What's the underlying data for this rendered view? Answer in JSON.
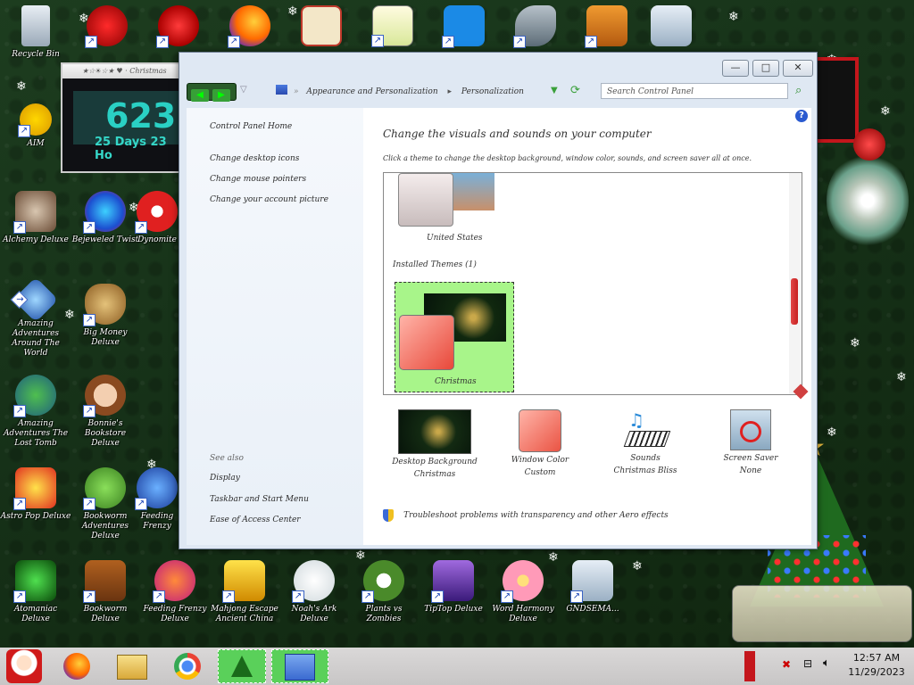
{
  "desktop": {
    "icons": [
      {
        "label": "Recycle Bin"
      },
      {
        "label": ""
      },
      {
        "label": ""
      },
      {
        "label": ""
      },
      {
        "label": ""
      },
      {
        "label": ""
      },
      {
        "label": ""
      },
      {
        "label": ""
      },
      {
        "label": ""
      },
      {
        "label": "AIM"
      },
      {
        "label": "Alchemy Deluxe"
      },
      {
        "label": "Bejeweled Twist"
      },
      {
        "label": "Dynomite"
      },
      {
        "label": "Amazing Adventures Around The World"
      },
      {
        "label": "Big Money Deluxe"
      },
      {
        "label": "Amazing Adventures The Lost Tomb"
      },
      {
        "label": "Bonnie's Bookstore Deluxe"
      },
      {
        "label": "Astro Pop Deluxe"
      },
      {
        "label": "Bookworm Adventures Deluxe"
      },
      {
        "label": "Feeding Frenzy"
      },
      {
        "label": "Atomaniac Deluxe"
      },
      {
        "label": "Bookworm Deluxe"
      },
      {
        "label": "Feeding Frenzy Deluxe"
      },
      {
        "label": "Mahjong Escape Ancient China"
      },
      {
        "label": "Noah's Ark Deluxe"
      },
      {
        "label": "Plants vs Zombies"
      },
      {
        "label": "TipTop Deluxe"
      },
      {
        "label": "Word Harmony Deluxe"
      },
      {
        "label": "GNDSEMA..."
      }
    ]
  },
  "gadget": {
    "title": "★☆☀☆★ ♥ · Christmas",
    "number": "623",
    "days": "25 Days 23 Ho"
  },
  "window": {
    "nav": {
      "back": "◀",
      "forward": "▶",
      "dropdown": "▽"
    },
    "breadcrumb": [
      "Appearance and Personalization",
      "Personalization"
    ],
    "breadcrumb_sep": "»",
    "search_placeholder": "Search Control Panel",
    "controls": {
      "minimize": "—",
      "maximize": "□",
      "close": "✕"
    },
    "help": "?",
    "sidebar": {
      "home": "Control Panel Home",
      "links": [
        "Change desktop icons",
        "Change mouse pointers",
        "Change your account picture"
      ],
      "see_also_title": "See also",
      "see_also": [
        "Display",
        "Taskbar and Start Menu",
        "Ease of Access Center"
      ]
    },
    "main": {
      "heading": "Change the visuals and sounds on your computer",
      "subheading": "Click a theme to change the desktop background, window color, sounds, and screen saver all at once.",
      "theme_top_label": "United States",
      "installed_header": "Installed Themes (1)",
      "selected_theme": "Christmas",
      "bottom_items": [
        {
          "title": "Desktop Background",
          "value": "Christmas"
        },
        {
          "title": "Window Color",
          "value": "Custom"
        },
        {
          "title": "Sounds",
          "value": "Christmas Bliss"
        },
        {
          "title": "Screen Saver",
          "value": "None"
        }
      ],
      "troubleshoot": "Troubleshoot problems with transparency and other Aero effects"
    }
  },
  "taskbar": {
    "clock_time": "12:57 AM",
    "clock_date": "11/29/2023"
  },
  "colors": {
    "accent": "#a8f58a",
    "window_bg": "#dfe8f3",
    "scroll_thumb": "#d63a3a"
  }
}
